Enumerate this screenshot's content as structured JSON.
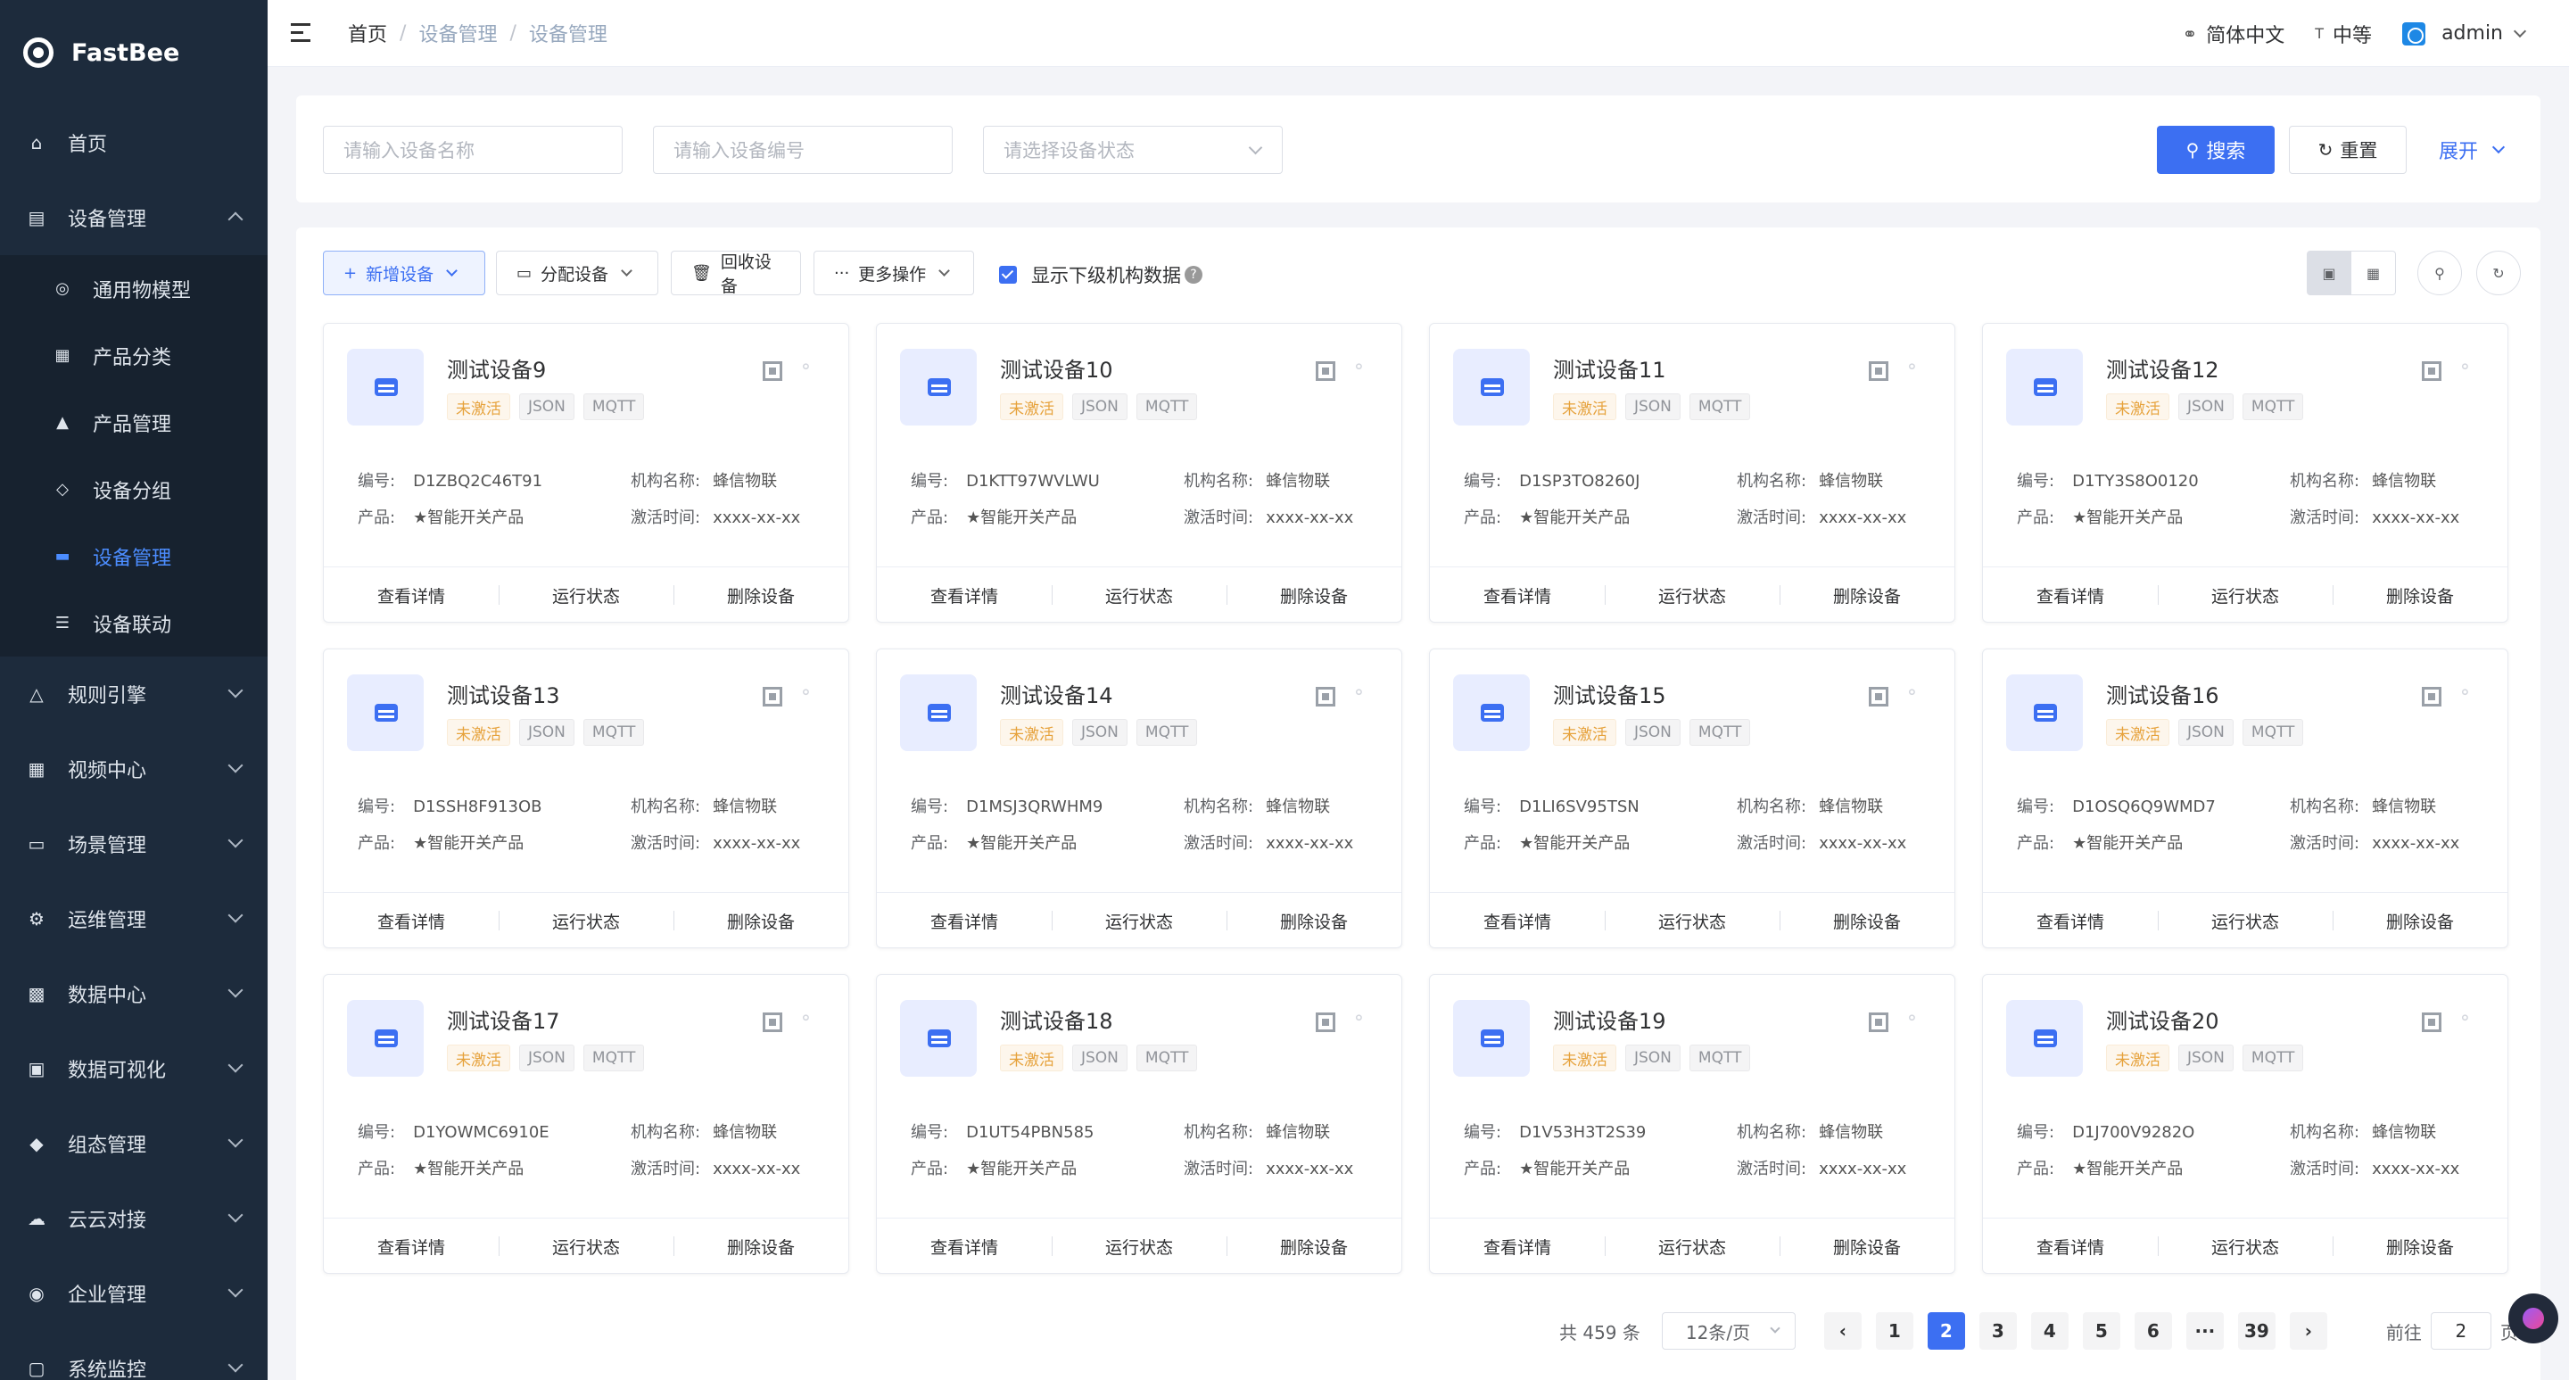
{
  "app": {
    "name": "FastBee"
  },
  "sidebar": {
    "items": [
      {
        "label": "首页",
        "icon": "home-icon",
        "expanded": null
      },
      {
        "label": "设备管理",
        "icon": "device-icon",
        "expanded": true,
        "children": [
          {
            "label": "通用物模型",
            "icon": "model-icon"
          },
          {
            "label": "产品分类",
            "icon": "category-icon"
          },
          {
            "label": "产品管理",
            "icon": "product-icon"
          },
          {
            "label": "设备分组",
            "icon": "group-icon"
          },
          {
            "label": "设备管理",
            "icon": "device-manage-icon",
            "active": true
          },
          {
            "label": "设备联动",
            "icon": "linkage-icon"
          }
        ]
      },
      {
        "label": "规则引擎",
        "icon": "rule-icon",
        "expanded": false
      },
      {
        "label": "视频中心",
        "icon": "video-icon",
        "expanded": false
      },
      {
        "label": "场景管理",
        "icon": "scene-icon",
        "expanded": false
      },
      {
        "label": "运维管理",
        "icon": "ops-icon",
        "expanded": false
      },
      {
        "label": "数据中心",
        "icon": "data-icon",
        "expanded": false
      },
      {
        "label": "数据可视化",
        "icon": "visual-icon",
        "expanded": false
      },
      {
        "label": "组态管理",
        "icon": "config-icon",
        "expanded": false
      },
      {
        "label": "云云对接",
        "icon": "cloud-icon",
        "expanded": false
      },
      {
        "label": "企业管理",
        "icon": "enterprise-icon",
        "expanded": false
      },
      {
        "label": "系统监控",
        "icon": "monitor-icon",
        "expanded": false
      }
    ]
  },
  "header": {
    "breadcrumb": [
      "首页",
      "设备管理",
      "设备管理"
    ],
    "language": "简体中文",
    "size": "中等",
    "user": "admin"
  },
  "search": {
    "name_placeholder": "请输入设备名称",
    "serial_placeholder": "请输入设备编号",
    "status_placeholder": "请选择设备状态",
    "search_label": "搜索",
    "reset_label": "重置",
    "expand_label": "展开"
  },
  "toolbar": {
    "add_label": "新增设备",
    "assign_label": "分配设备",
    "recycle_label": "回收设备",
    "more_label": "更多操作",
    "show_sub_label": "显示下级机构数据"
  },
  "labels": {
    "serial": "编号:",
    "org": "机构名称:",
    "product": "产品:",
    "activated": "激活时间:",
    "detail": "查看详情",
    "run_status": "运行状态",
    "delete": "删除设备"
  },
  "devices": [
    {
      "name": "测试设备9",
      "status": "未激活",
      "format": "JSON",
      "protocol": "MQTT",
      "serial": "D1ZBQ2C46T91",
      "org": "蜂信物联",
      "product": "★智能开关产品",
      "activated": "xxxx-xx-xx"
    },
    {
      "name": "测试设备10",
      "status": "未激活",
      "format": "JSON",
      "protocol": "MQTT",
      "serial": "D1KTT97WVLWU",
      "org": "蜂信物联",
      "product": "★智能开关产品",
      "activated": "xxxx-xx-xx"
    },
    {
      "name": "测试设备11",
      "status": "未激活",
      "format": "JSON",
      "protocol": "MQTT",
      "serial": "D1SP3TO8260J",
      "org": "蜂信物联",
      "product": "★智能开关产品",
      "activated": "xxxx-xx-xx"
    },
    {
      "name": "测试设备12",
      "status": "未激活",
      "format": "JSON",
      "protocol": "MQTT",
      "serial": "D1TY3S8O0120",
      "org": "蜂信物联",
      "product": "★智能开关产品",
      "activated": "xxxx-xx-xx"
    },
    {
      "name": "测试设备13",
      "status": "未激活",
      "format": "JSON",
      "protocol": "MQTT",
      "serial": "D1SSH8F913OB",
      "org": "蜂信物联",
      "product": "★智能开关产品",
      "activated": "xxxx-xx-xx"
    },
    {
      "name": "测试设备14",
      "status": "未激活",
      "format": "JSON",
      "protocol": "MQTT",
      "serial": "D1MSJ3QRWHM9",
      "org": "蜂信物联",
      "product": "★智能开关产品",
      "activated": "xxxx-xx-xx"
    },
    {
      "name": "测试设备15",
      "status": "未激活",
      "format": "JSON",
      "protocol": "MQTT",
      "serial": "D1LI6SV95TSN",
      "org": "蜂信物联",
      "product": "★智能开关产品",
      "activated": "xxxx-xx-xx"
    },
    {
      "name": "测试设备16",
      "status": "未激活",
      "format": "JSON",
      "protocol": "MQTT",
      "serial": "D1OSQ6Q9WMD7",
      "org": "蜂信物联",
      "product": "★智能开关产品",
      "activated": "xxxx-xx-xx"
    },
    {
      "name": "测试设备17",
      "status": "未激活",
      "format": "JSON",
      "protocol": "MQTT",
      "serial": "D1YOWMC6910E",
      "org": "蜂信物联",
      "product": "★智能开关产品",
      "activated": "xxxx-xx-xx"
    },
    {
      "name": "测试设备18",
      "status": "未激活",
      "format": "JSON",
      "protocol": "MQTT",
      "serial": "D1UT54PBN585",
      "org": "蜂信物联",
      "product": "★智能开关产品",
      "activated": "xxxx-xx-xx"
    },
    {
      "name": "测试设备19",
      "status": "未激活",
      "format": "JSON",
      "protocol": "MQTT",
      "serial": "D1V53H3T2S39",
      "org": "蜂信物联",
      "product": "★智能开关产品",
      "activated": "xxxx-xx-xx"
    },
    {
      "name": "测试设备20",
      "status": "未激活",
      "format": "JSON",
      "protocol": "MQTT",
      "serial": "D1J700V9282O",
      "org": "蜂信物联",
      "product": "★智能开关产品",
      "activated": "xxxx-xx-xx"
    }
  ],
  "pagination": {
    "total": "共 459 条",
    "page_size": "12条/页",
    "pages": [
      "1",
      "2",
      "3",
      "4",
      "5",
      "6",
      "···",
      "39"
    ],
    "current": "2",
    "goto_prefix": "前往",
    "goto_value": "2",
    "goto_suffix": "页"
  },
  "colors": {
    "sidebar_bg": "#1d2b3c",
    "primary": "#3c6ff2",
    "warning": "#e6a23c"
  }
}
